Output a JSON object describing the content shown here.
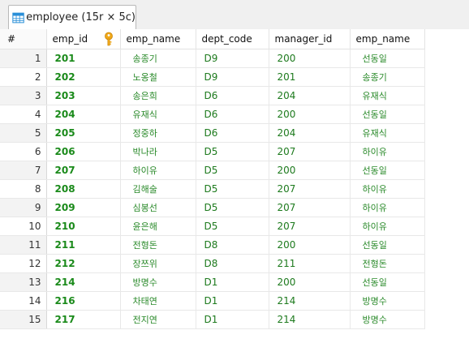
{
  "tab": {
    "title": "employee (15r × 5c)"
  },
  "table": {
    "columns": [
      "#",
      "emp_id",
      "emp_name",
      "dept_code",
      "manager_id",
      "emp_name"
    ],
    "rows": [
      {
        "n": "1",
        "emp_id": "201",
        "emp_name": "송종기",
        "dept_code": "D9",
        "manager_id": "200",
        "mgr_name": "선동일"
      },
      {
        "n": "2",
        "emp_id": "202",
        "emp_name": "노옹철",
        "dept_code": "D9",
        "manager_id": "201",
        "mgr_name": "송종기"
      },
      {
        "n": "3",
        "emp_id": "203",
        "emp_name": "송은희",
        "dept_code": "D6",
        "manager_id": "204",
        "mgr_name": "유재식"
      },
      {
        "n": "4",
        "emp_id": "204",
        "emp_name": "유재식",
        "dept_code": "D6",
        "manager_id": "200",
        "mgr_name": "선동일"
      },
      {
        "n": "5",
        "emp_id": "205",
        "emp_name": "정중하",
        "dept_code": "D6",
        "manager_id": "204",
        "mgr_name": "유재식"
      },
      {
        "n": "6",
        "emp_id": "206",
        "emp_name": "박나라",
        "dept_code": "D5",
        "manager_id": "207",
        "mgr_name": "하이유"
      },
      {
        "n": "7",
        "emp_id": "207",
        "emp_name": "하이유",
        "dept_code": "D5",
        "manager_id": "200",
        "mgr_name": "선동일"
      },
      {
        "n": "8",
        "emp_id": "208",
        "emp_name": "김해술",
        "dept_code": "D5",
        "manager_id": "207",
        "mgr_name": "하이유"
      },
      {
        "n": "9",
        "emp_id": "209",
        "emp_name": "심봉선",
        "dept_code": "D5",
        "manager_id": "207",
        "mgr_name": "하이유"
      },
      {
        "n": "10",
        "emp_id": "210",
        "emp_name": "윤은해",
        "dept_code": "D5",
        "manager_id": "207",
        "mgr_name": "하이유"
      },
      {
        "n": "11",
        "emp_id": "211",
        "emp_name": "전형돈",
        "dept_code": "D8",
        "manager_id": "200",
        "mgr_name": "선동일"
      },
      {
        "n": "12",
        "emp_id": "212",
        "emp_name": "장쯔위",
        "dept_code": "D8",
        "manager_id": "211",
        "mgr_name": "전형돈"
      },
      {
        "n": "13",
        "emp_id": "214",
        "emp_name": "방명수",
        "dept_code": "D1",
        "manager_id": "200",
        "mgr_name": "선동일"
      },
      {
        "n": "14",
        "emp_id": "216",
        "emp_name": "차태연",
        "dept_code": "D1",
        "manager_id": "214",
        "mgr_name": "방명수"
      },
      {
        "n": "15",
        "emp_id": "217",
        "emp_name": "전지연",
        "dept_code": "D1",
        "manager_id": "214",
        "mgr_name": "방명수"
      }
    ]
  },
  "icons": {
    "tab": "table-grid-icon",
    "primary_key": "key-icon"
  },
  "colors": {
    "cell_text": "#1b7a1b",
    "header_text": "#111111",
    "tab_icon": "#2a8fd8",
    "key_icon": "#f0a818"
  }
}
